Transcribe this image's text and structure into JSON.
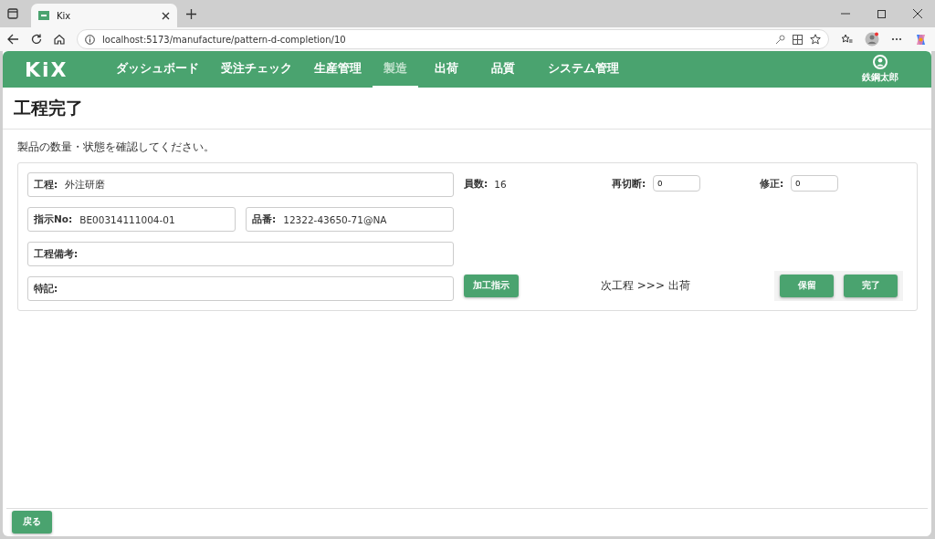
{
  "browser": {
    "tab_title": "Kix",
    "url": "localhost:5173/manufacture/pattern-d-completion/10"
  },
  "app": {
    "logo": "KiX",
    "nav": [
      {
        "label": "ダッシュボード",
        "selected": false
      },
      {
        "label": "受注チェック",
        "selected": false
      },
      {
        "label": "生産管理",
        "selected": false
      },
      {
        "label": "製造",
        "selected": true
      },
      {
        "label": "出荷",
        "selected": false
      },
      {
        "label": "品質",
        "selected": false
      },
      {
        "label": "システム管理",
        "selected": false
      }
    ],
    "user": "鉄鋼太郎"
  },
  "page": {
    "title": "工程完了",
    "instruction": "製品の数量・状態を確認してください。"
  },
  "form": {
    "process": {
      "label": "工程:",
      "value": "外注研磨"
    },
    "order_no": {
      "label": "指示No:",
      "value": "BE00314111004-01"
    },
    "part_no": {
      "label": "品番:",
      "value": "12322-43650-71@NA"
    },
    "process_note": {
      "label": "工程備考:"
    },
    "special_note": {
      "label": "特記:"
    },
    "quantity": {
      "label": "員数:",
      "value": "16"
    },
    "recut": {
      "label": "再切断:",
      "value": "0"
    },
    "correction": {
      "label": "修正:",
      "value": "0"
    },
    "instruction_button": "加工指示",
    "next_process": "次工程 >>> 出荷",
    "hold_button": "保留",
    "complete_button": "完了"
  },
  "footer": {
    "back_button": "戻る"
  }
}
